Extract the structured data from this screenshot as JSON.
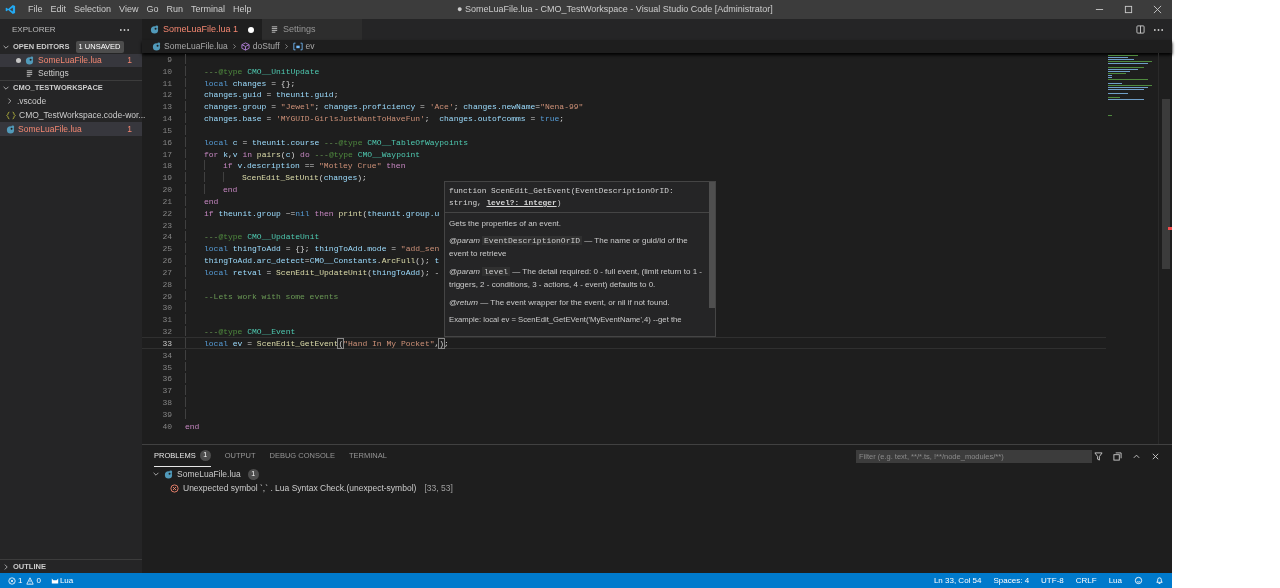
{
  "window": {
    "title": "● SomeLuaFile.lua - CMO_TestWorkspace - Visual Studio Code [Administrator]"
  },
  "menu": [
    "File",
    "Edit",
    "Selection",
    "View",
    "Go",
    "Run",
    "Terminal",
    "Help"
  ],
  "sidebar": {
    "title": "EXPLORER",
    "open_editors": {
      "title": "OPEN EDITORS",
      "badge": "1 UNSAVED",
      "expanded": true,
      "items": [
        {
          "label": "SomeLuaFile.lua",
          "kind": "lua",
          "dirty": true,
          "error": true,
          "problems": "1",
          "selected": true
        },
        {
          "label": "Settings",
          "kind": "settings",
          "dirty": false,
          "error": false,
          "selected": false
        }
      ]
    },
    "workspace": {
      "title": "CMO_TESTWORKSPACE",
      "expanded": true,
      "items": [
        {
          "label": ".vscode",
          "kind": "folder",
          "error": false,
          "selected": false
        },
        {
          "label": "CMO_TestWorkspace.code-wor...",
          "kind": "json",
          "error": false,
          "selected": false
        },
        {
          "label": "SomeLuaFile.lua",
          "kind": "lua",
          "error": true,
          "problems": "1",
          "selected": true
        }
      ]
    },
    "outline": {
      "title": "OUTLINE",
      "expanded": false
    }
  },
  "tabs": [
    {
      "label": "SomeLuaFile.lua",
      "kind": "lua",
      "problems": "1",
      "dirty": true,
      "error": true,
      "selected": true
    },
    {
      "label": "Settings",
      "kind": "settings",
      "dirty": false,
      "error": false,
      "selected": false
    }
  ],
  "breadcrumbs": [
    {
      "label": "SomeLuaFile.lua",
      "kind": "file"
    },
    {
      "label": "doStuff",
      "kind": "function"
    },
    {
      "label": "ev",
      "kind": "variable"
    }
  ],
  "editor": {
    "body": [
      {
        "n": "9",
        "current": false
      },
      {
        "n": "10",
        "current": false,
        "tokens": [
          {
            "kind": "comment",
            "text": "---"
          },
          {
            "kind": "annotation",
            "text": "@type"
          },
          {
            "kind": "type",
            "text": " CMO__UnitUpdate"
          }
        ]
      },
      {
        "n": "11",
        "current": false,
        "tokens": [
          {
            "kind": "keyword",
            "text": "local"
          },
          {
            "kind": "variable",
            "text": " changes"
          },
          {
            "kind": "plain",
            "text": " = {};"
          }
        ]
      },
      {
        "n": "12",
        "current": false,
        "tokens": [
          {
            "kind": "variable",
            "text": "changes.guid"
          },
          {
            "kind": "plain",
            "text": " = "
          },
          {
            "kind": "variable",
            "text": "theunit.guid"
          },
          {
            "kind": "plain",
            "text": ";"
          }
        ]
      },
      {
        "n": "13",
        "current": false,
        "tokens": [
          {
            "kind": "variable",
            "text": "changes.group"
          },
          {
            "kind": "plain",
            "text": " = "
          },
          {
            "kind": "string",
            "text": "\"Jewel\""
          },
          {
            "kind": "plain",
            "text": "; "
          },
          {
            "kind": "variable",
            "text": "changes.proficiency"
          },
          {
            "kind": "plain",
            "text": " = "
          },
          {
            "kind": "string",
            "text": "'Ace'"
          },
          {
            "kind": "plain",
            "text": "; "
          },
          {
            "kind": "variable",
            "text": "changes.newName"
          },
          {
            "kind": "plain",
            "text": "="
          },
          {
            "kind": "string",
            "text": "\"Nena-99\""
          }
        ]
      },
      {
        "n": "14",
        "current": false,
        "tokens": [
          {
            "kind": "variable",
            "text": "changes.base"
          },
          {
            "kind": "plain",
            "text": " = "
          },
          {
            "kind": "string",
            "text": "'MYGUID-GirlsJustWantToHaveFun'"
          },
          {
            "kind": "plain",
            "text": ";  "
          },
          {
            "kind": "variable",
            "text": "changes.outofcomms"
          },
          {
            "kind": "plain",
            "text": " = "
          },
          {
            "kind": "keyword",
            "text": "true"
          },
          {
            "kind": "plain",
            "text": ";"
          }
        ]
      },
      {
        "n": "15",
        "current": false
      },
      {
        "n": "16",
        "current": false,
        "tokens": [
          {
            "kind": "keyword",
            "text": "local"
          },
          {
            "kind": "variable",
            "text": " c"
          },
          {
            "kind": "plain",
            "text": " = "
          },
          {
            "kind": "variable",
            "text": "theunit.course "
          },
          {
            "kind": "comment",
            "text": "---"
          },
          {
            "kind": "annotation",
            "text": "@type"
          },
          {
            "kind": "type",
            "text": " CMO__TableOfWaypoints"
          }
        ]
      },
      {
        "n": "17",
        "current": false,
        "tokens": [
          {
            "kind": "control",
            "text": "for"
          },
          {
            "kind": "variable",
            "text": " k"
          },
          {
            "kind": "plain",
            "text": ","
          },
          {
            "kind": "variable",
            "text": "v"
          },
          {
            "kind": "control",
            "text": " in"
          },
          {
            "kind": "function",
            "text": " pairs"
          },
          {
            "kind": "plain",
            "text": "("
          },
          {
            "kind": "variable",
            "text": "c"
          },
          {
            "kind": "plain",
            "text": ") "
          },
          {
            "kind": "control",
            "text": "do "
          },
          {
            "kind": "comment",
            "text": "---"
          },
          {
            "kind": "annotation",
            "text": "@type"
          },
          {
            "kind": "type",
            "text": " CMO__Waypoint"
          }
        ],
        "children": [
          {
            "n": "18",
            "current": false,
            "tokens": [
              {
                "kind": "control",
                "text": "if"
              },
              {
                "kind": "variable",
                "text": " v.description"
              },
              {
                "kind": "plain",
                "text": " == "
              },
              {
                "kind": "string",
                "text": "\"Motley Crue\""
              },
              {
                "kind": "control",
                "text": " then"
              }
            ],
            "children": [
              {
                "n": "19",
                "current": false,
                "tokens": [
                  {
                    "kind": "function",
                    "text": "ScenEdit_SetUnit"
                  },
                  {
                    "kind": "plain",
                    "text": "("
                  },
                  {
                    "kind": "variable",
                    "text": "changes"
                  },
                  {
                    "kind": "plain",
                    "text": ");"
                  }
                ]
              }
            ]
          },
          {
            "n": "20",
            "current": false,
            "tokens": [
              {
                "kind": "control",
                "text": "end"
              }
            ]
          }
        ]
      },
      {
        "n": "21",
        "current": false,
        "tokens": [
          {
            "kind": "control",
            "text": "end"
          }
        ]
      },
      {
        "n": "22",
        "current": false,
        "tokens": [
          {
            "kind": "control",
            "text": "if"
          },
          {
            "kind": "variable",
            "text": " theunit.group"
          },
          {
            "kind": "plain",
            "text": " ~="
          },
          {
            "kind": "keyword",
            "text": "nil"
          },
          {
            "kind": "control",
            "text": " then"
          },
          {
            "kind": "function",
            "text": " print"
          },
          {
            "kind": "plain",
            "text": "("
          },
          {
            "kind": "variable",
            "text": "theunit.group.u"
          }
        ]
      },
      {
        "n": "23",
        "current": false
      },
      {
        "n": "24",
        "current": false,
        "tokens": [
          {
            "kind": "comment",
            "text": "---"
          },
          {
            "kind": "annotation",
            "text": "@type"
          },
          {
            "kind": "type",
            "text": " CMO__UpdateUnit"
          }
        ]
      },
      {
        "n": "25",
        "current": false,
        "tokens": [
          {
            "kind": "keyword",
            "text": "local"
          },
          {
            "kind": "variable",
            "text": " thingToAdd"
          },
          {
            "kind": "plain",
            "text": " = {}; "
          },
          {
            "kind": "variable",
            "text": "thingToAdd.mode"
          },
          {
            "kind": "plain",
            "text": " = "
          },
          {
            "kind": "string",
            "text": "\"add_sen"
          }
        ]
      },
      {
        "n": "26",
        "current": false,
        "tokens": [
          {
            "kind": "variable",
            "text": "thingToAdd.arc_detect"
          },
          {
            "kind": "plain",
            "text": "="
          },
          {
            "kind": "variable",
            "text": "CMO__Constants"
          },
          {
            "kind": "plain",
            "text": "."
          },
          {
            "kind": "function",
            "text": "ArcFull"
          },
          {
            "kind": "plain",
            "text": "(); "
          },
          {
            "kind": "variable",
            "text": "t"
          }
        ]
      },
      {
        "n": "27",
        "current": false,
        "tokens": [
          {
            "kind": "keyword",
            "text": "local"
          },
          {
            "kind": "variable",
            "text": " retval"
          },
          {
            "kind": "plain",
            "text": " = "
          },
          {
            "kind": "function",
            "text": "ScenEdit_UpdateUnit"
          },
          {
            "kind": "plain",
            "text": "("
          },
          {
            "kind": "variable",
            "text": "thingToAdd"
          },
          {
            "kind": "plain",
            "text": "); -"
          }
        ]
      },
      {
        "n": "28",
        "current": false
      },
      {
        "n": "29",
        "current": false,
        "tokens": [
          {
            "kind": "comment",
            "text": "--Lets work with some events"
          }
        ]
      },
      {
        "n": "30",
        "current": false
      },
      {
        "n": "31",
        "current": false
      },
      {
        "n": "32",
        "current": false,
        "tokens": [
          {
            "kind": "comment",
            "text": "---"
          },
          {
            "kind": "annotation",
            "text": "@type"
          },
          {
            "kind": "type",
            "text": " CMO__Event"
          }
        ]
      },
      {
        "n": "33",
        "current": true,
        "tokens": [
          {
            "kind": "keyword",
            "text": "local"
          },
          {
            "kind": "variable",
            "text": " ev"
          },
          {
            "kind": "plain",
            "text": " = "
          },
          {
            "kind": "function",
            "text": "ScenEdit_GetEvent"
          },
          {
            "kind": "bracket",
            "text": "("
          },
          {
            "kind": "string",
            "text": "\"Hand In My Pocket\""
          },
          {
            "kind": "plain",
            "text": ","
          },
          {
            "kind": "bracket",
            "text": ")"
          },
          {
            "kind": "plain",
            "text": ";"
          }
        ]
      },
      {
        "n": "34",
        "current": false
      },
      {
        "n": "35",
        "current": false
      },
      {
        "n": "36",
        "current": false
      },
      {
        "n": "37",
        "current": false
      },
      {
        "n": "38",
        "current": false
      },
      {
        "n": "39",
        "current": false
      }
    ],
    "closing": [
      {
        "n": "40",
        "current": false,
        "tokens": [
          {
            "kind": "control",
            "text": "end"
          }
        ]
      }
    ],
    "hover": {
      "signature": "function ScenEdit_GetEvent(EventDescriptionOrID: string, **level?: integer**)",
      "description": "Gets the properties of an event.",
      "params": [
        {
          "tag": "@param",
          "name": "EventDescriptionOrID",
          "text": "— The name or guid/id of the event to retrieve"
        },
        {
          "tag": "@param",
          "name": "level",
          "text": "— The detail required: 0 - full event, (limit return to 1 - triggers, 2 - conditions, 3 - actions, 4 - event) defaults to 0."
        },
        {
          "tag": "@return",
          "text": "— The event wrapper for the event, or nil if not found."
        }
      ],
      "example": "Example: local ev = ScenEdit_GetEVent('MyEventName',4) --get the"
    }
  },
  "panel": {
    "tabs": [
      {
        "label": "PROBLEMS",
        "badge": "1",
        "selected": true
      },
      {
        "label": "OUTPUT",
        "selected": false
      },
      {
        "label": "DEBUG CONSOLE",
        "selected": false
      },
      {
        "label": "TERMINAL",
        "selected": false
      }
    ],
    "filter": {
      "placeholder": "Filter (e.g. text, **/*.ts, !**/node_modules/**)"
    },
    "problems": [
      {
        "file": "SomeLuaFile.lua",
        "count": "1",
        "expanded": true,
        "items": [
          {
            "kind": "error",
            "message": "Unexpected symbol `,` . Lua Syntax Check.(unexpect-symbol)",
            "location": "[33, 53]"
          }
        ]
      }
    ]
  },
  "status_bar": {
    "errors": "1",
    "warnings": "0",
    "language_server": "Lua",
    "right": [
      "Ln 33, Col 54",
      "Spaces: 4",
      "UTF-8",
      "CRLF",
      "Lua"
    ]
  }
}
